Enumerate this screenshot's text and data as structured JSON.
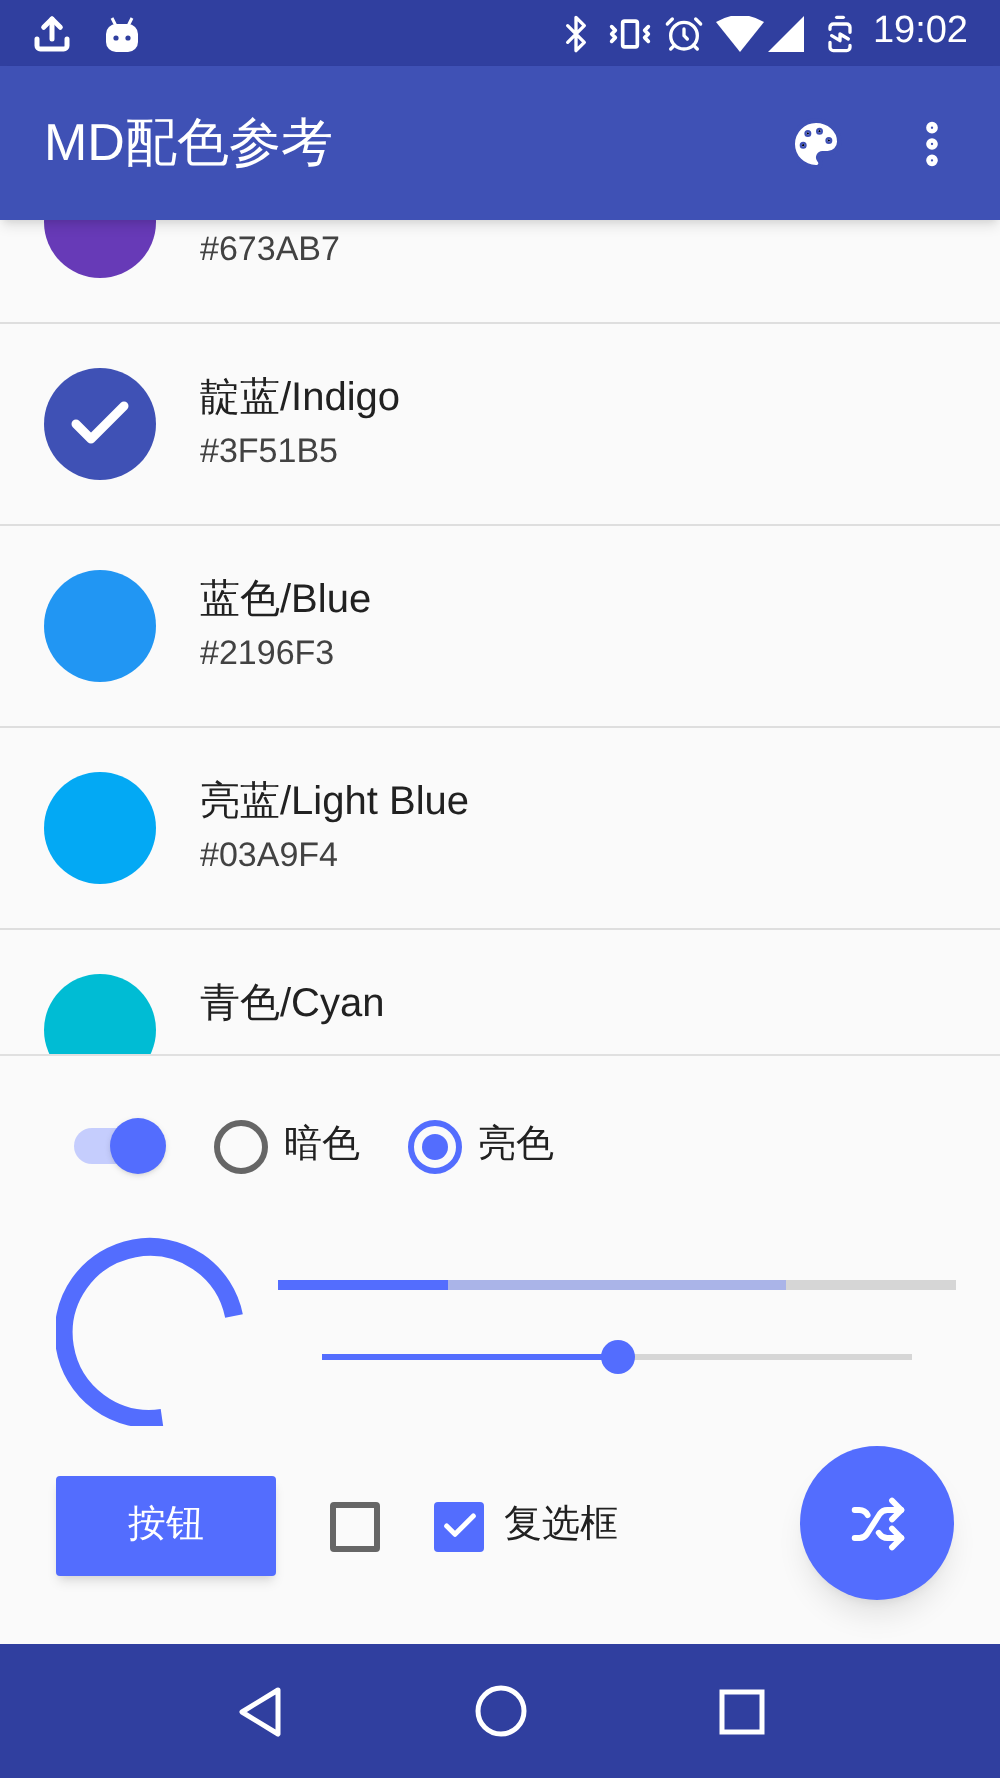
{
  "status_bar": {
    "time": "19:02"
  },
  "app_bar": {
    "title": "MD配色参考"
  },
  "colors": [
    {
      "hex": "#673AB7",
      "color": "#673ab7",
      "selected": false
    },
    {
      "name": "靛蓝/Indigo",
      "hex": "#3F51B5",
      "color": "#3f51b5",
      "selected": true
    },
    {
      "name": "蓝色/Blue",
      "hex": "#2196F3",
      "color": "#2196f3",
      "selected": false
    },
    {
      "name": "亮蓝/Light Blue",
      "hex": "#03A9F4",
      "color": "#03a9f4",
      "selected": false
    },
    {
      "name": "青色/Cyan",
      "color": "#00bcd4",
      "selected": false
    }
  ],
  "switch": {
    "on": true
  },
  "radios": [
    {
      "label": "暗色",
      "selected": false
    },
    {
      "label": "亮色",
      "selected": true
    }
  ],
  "progress_bar": {
    "level": 0.25,
    "buffer": {
      "level": 0.75
    }
  },
  "slider": {
    "level": 0.5
  },
  "button": {
    "label": "按钮"
  },
  "checkboxes": [
    {
      "checked": false
    },
    {
      "label": "复选框",
      "checked": true
    }
  ]
}
